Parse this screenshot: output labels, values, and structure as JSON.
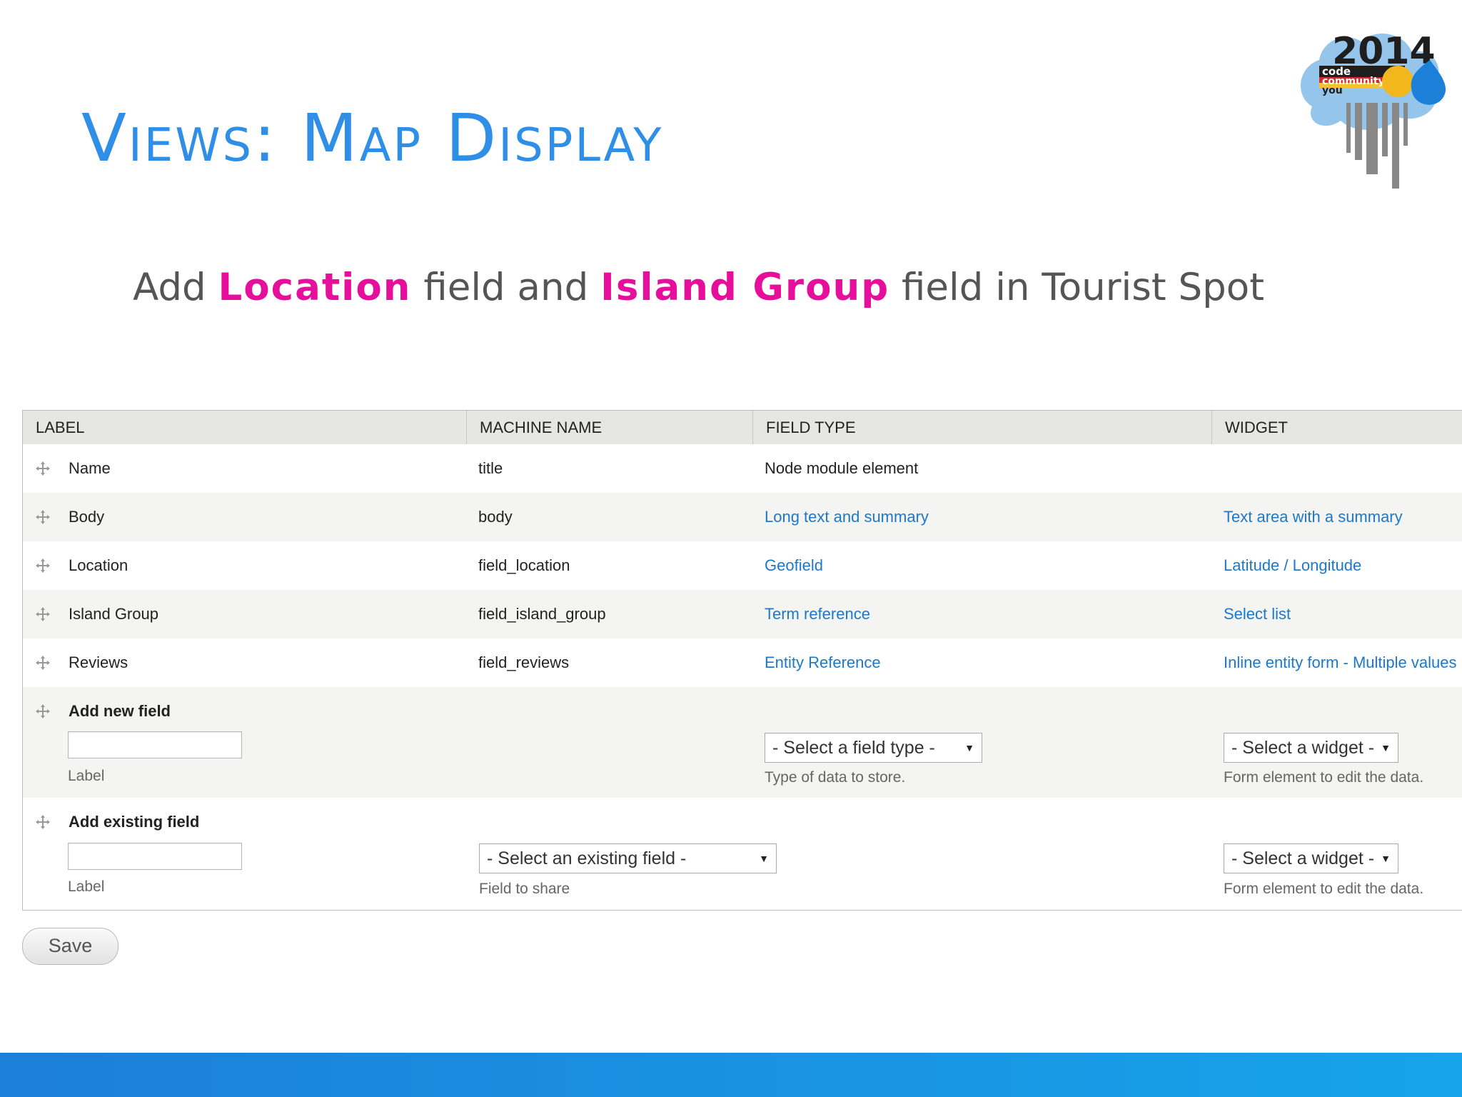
{
  "slide": {
    "title": "Views: Map Display",
    "subtitle": {
      "part1": "Add ",
      "highlight1": "Location",
      "part2": " field and ",
      "highlight2": "Island Group",
      "part3": " field in Tourist Spot"
    },
    "logo": {
      "year": "2014",
      "line1": "code",
      "line2": "community",
      "line3": "you"
    }
  },
  "colors": {
    "title": "#2f8fe6",
    "highlight": "#e60f9c",
    "link": "#1d78c7",
    "bar": "#1c7fd8"
  },
  "table": {
    "headers": [
      "LABEL",
      "MACHINE NAME",
      "FIELD TYPE",
      "WIDGET"
    ],
    "rows": [
      {
        "label": "Name",
        "machine": "title",
        "type": "Node module element",
        "widget": ""
      },
      {
        "label": "Body",
        "machine": "body",
        "type": "Long text and summary",
        "widget": "Text area with a summary"
      },
      {
        "label": "Location",
        "machine": "field_location",
        "type": "Geofield",
        "widget": "Latitude / Longitude"
      },
      {
        "label": "Island Group",
        "machine": "field_island_group",
        "type": "Term reference",
        "widget": "Select list"
      },
      {
        "label": "Reviews",
        "machine": "field_reviews",
        "type": "Entity Reference",
        "widget": "Inline entity form - Multiple values"
      }
    ],
    "add_new": {
      "title": "Add new field",
      "label_desc": "Label",
      "type_select": "- Select a field type -",
      "type_desc": "Type of data to store.",
      "widget_select": "- Select a widget -",
      "widget_desc": "Form element to edit the data."
    },
    "add_existing": {
      "title": "Add existing field",
      "label_desc": "Label",
      "field_select": "- Select an existing field -",
      "field_desc": "Field to share",
      "widget_select": "- Select a widget -",
      "widget_desc": "Form element to edit the data."
    }
  },
  "save_label": "Save"
}
